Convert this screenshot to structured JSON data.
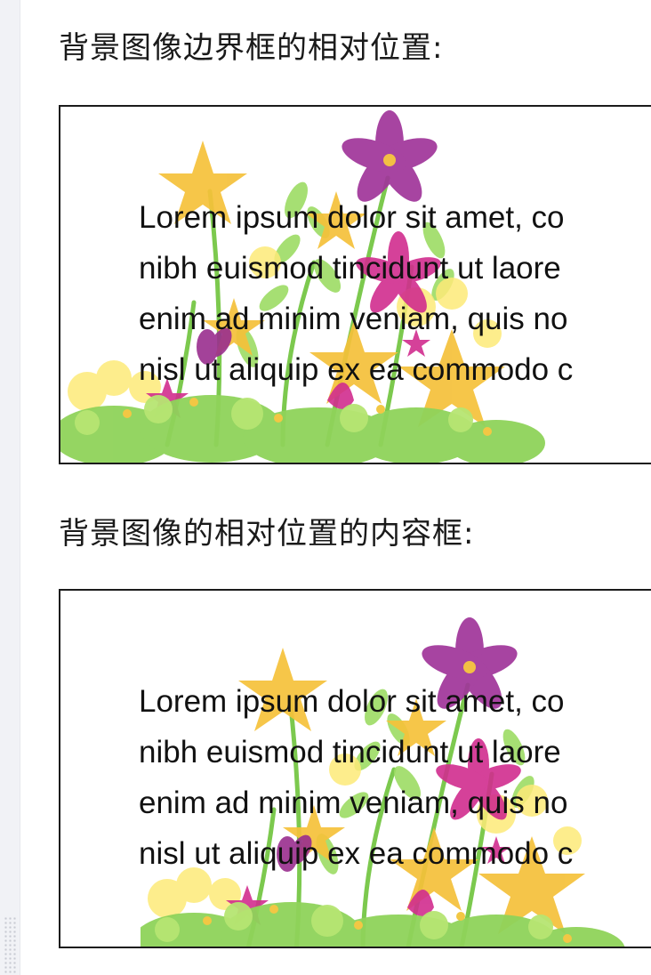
{
  "section1": {
    "heading": "背景图像边界框的相对位置:",
    "lines": [
      "Lorem ipsum dolor sit amet, co",
      "nibh euismod tincidunt ut laore",
      "enim ad minim veniam, quis no",
      "nisl ut aliquip ex ea commodo c"
    ]
  },
  "section2": {
    "heading": "背景图像的相对位置的内容框:",
    "lines": [
      "Lorem ipsum dolor sit amet, co",
      "nibh euismod tincidunt ut laore",
      "enim ad minim veniam, quis no",
      "nisl ut aliquip ex ea commodo c"
    ]
  },
  "colors": {
    "border": "#1b1b1b",
    "text": "#111111",
    "flower_purple": "#a0359a",
    "flower_magenta": "#d12d8e",
    "flower_yellow": "#f5c13a",
    "grass_green": "#8fd35a"
  }
}
